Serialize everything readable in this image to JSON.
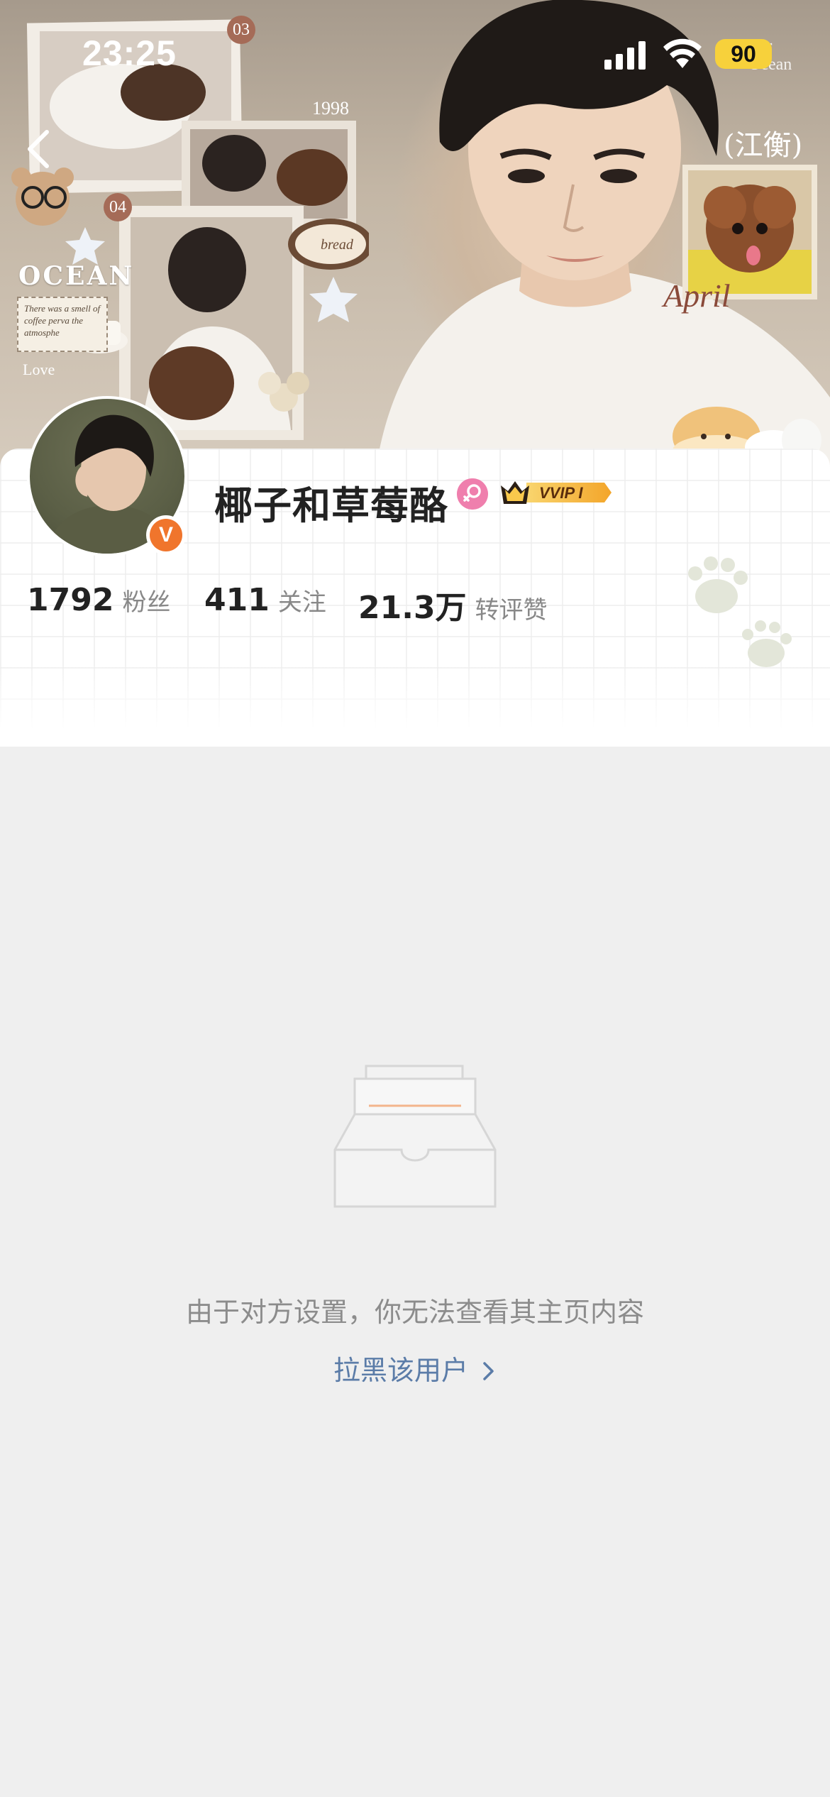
{
  "status_bar": {
    "time": "23:25",
    "battery": "90"
  },
  "banner": {
    "stickers": {
      "ocean": "OCEAN",
      "love": "Love",
      "april": "April",
      "year": "1998",
      "num_03": "03",
      "num_04": "04",
      "note": "There was a smell of coffee perva the atmosphe",
      "bread": "bread",
      "for_ocean": "For\nOcean",
      "jiangheng": "(江衡)"
    }
  },
  "profile": {
    "username": "椰子和草莓酪",
    "vip_label": "VVIP I",
    "verified_mark": "V",
    "stats": [
      {
        "value": "1792",
        "label": "粉丝"
      },
      {
        "value": "411",
        "label": "关注"
      },
      {
        "value": "21.3万",
        "label": "转评赞"
      }
    ]
  },
  "empty_state": {
    "message": "由于对方设置，你无法查看其主页内容",
    "block_link": "拉黑该用户"
  },
  "colors": {
    "accent_orange": "#f0752c",
    "link_blue": "#5b7ca8",
    "battery_yellow": "#f7d13b",
    "gender_pink": "#ef7fad"
  }
}
